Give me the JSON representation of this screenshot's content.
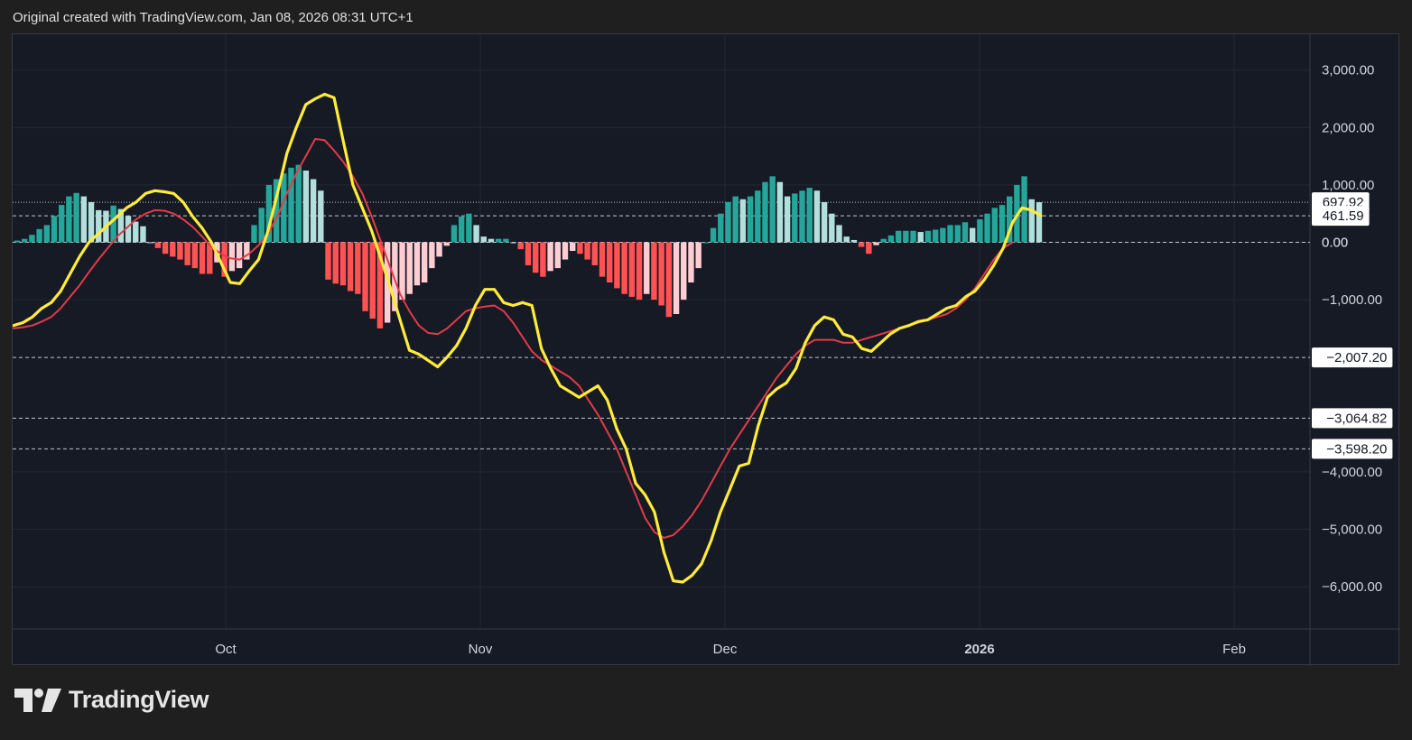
{
  "header": {
    "caption": "Original created with TradingView.com, Jan 08, 2026 08:31 UTC+1"
  },
  "brand": {
    "name": "TradingView",
    "logo_icon": "tradingview-logo-icon"
  },
  "colors": {
    "background": "#1f1f1f",
    "pane": "#161a25",
    "grid": "#242834",
    "axis_text": "#d1d4dc",
    "macd_line": "#ffeb3b",
    "signal_line": "#e23a48",
    "hist_pos_up": "#26a69a",
    "hist_pos_down": "#b2dfdb",
    "hist_neg_down": "#ff5252",
    "hist_neg_up": "#ffcdd2"
  },
  "chart_data": {
    "type": "line",
    "title": "",
    "xlabel": "",
    "ylabel": "",
    "ylim": [
      -6200,
      3400
    ],
    "x_ticks": [
      {
        "label": "Oct",
        "bold": false
      },
      {
        "label": "Nov",
        "bold": false
      },
      {
        "label": "Dec",
        "bold": false
      },
      {
        "label": "2026",
        "bold": true
      },
      {
        "label": "Feb",
        "bold": false
      }
    ],
    "y_ticks": [
      "3,000.00",
      "2,000.00",
      "1,000.00",
      "0.00",
      "−1,000.00",
      "−4,000.00",
      "−5,000.00",
      "−6,000.00"
    ],
    "y_tick_values": [
      3000,
      2000,
      1000,
      0,
      -1000,
      -4000,
      -5000,
      -6000
    ],
    "price_labels": [
      {
        "text": "697.92",
        "value": 697.92,
        "style": "dotted"
      },
      {
        "text": "461.59",
        "value": 461.59,
        "style": "dashed"
      },
      {
        "text": "−2,007.20",
        "value": -2007.2,
        "style": "dashed"
      },
      {
        "text": "−3,064.82",
        "value": -3064.82,
        "style": "dashed"
      },
      {
        "text": "−3,598.20",
        "value": -3598.2,
        "style": "dashed"
      }
    ],
    "zero_line_label": "0.00",
    "grid": true,
    "legend": "none",
    "series": [
      {
        "kind": "line",
        "color": "#ffeb3b",
        "points": [
          [
            0,
            -1450
          ],
          [
            1,
            -1400
          ],
          [
            2,
            -1300
          ],
          [
            3,
            -1150
          ],
          [
            4,
            -1050
          ],
          [
            5,
            -850
          ],
          [
            6,
            -550
          ],
          [
            7,
            -250
          ],
          [
            8,
            0
          ],
          [
            9,
            150
          ],
          [
            10,
            300
          ],
          [
            11,
            450
          ],
          [
            12,
            600
          ],
          [
            13,
            700
          ],
          [
            14,
            850
          ],
          [
            15,
            900
          ],
          [
            16,
            880
          ],
          [
            17,
            850
          ],
          [
            18,
            700
          ],
          [
            19,
            450
          ],
          [
            20,
            250
          ],
          [
            21,
            0
          ],
          [
            22,
            -350
          ],
          [
            23,
            -700
          ],
          [
            24,
            -720
          ],
          [
            25,
            -500
          ],
          [
            26,
            -300
          ],
          [
            27,
            200
          ],
          [
            28,
            850
          ],
          [
            29,
            1550
          ],
          [
            30,
            2000
          ],
          [
            31,
            2400
          ],
          [
            32,
            2500
          ],
          [
            33,
            2580
          ],
          [
            34,
            2520
          ],
          [
            35,
            1750
          ],
          [
            36,
            1000
          ],
          [
            37,
            600
          ],
          [
            38,
            200
          ],
          [
            39,
            -300
          ],
          [
            40,
            -800
          ],
          [
            41,
            -1350
          ],
          [
            42,
            -1880
          ],
          [
            43,
            -1950
          ],
          [
            44,
            -2060
          ],
          [
            45,
            -2170
          ],
          [
            46,
            -2000
          ],
          [
            47,
            -1800
          ],
          [
            48,
            -1500
          ],
          [
            49,
            -1100
          ],
          [
            50,
            -820
          ],
          [
            51,
            -820
          ],
          [
            52,
            -1050
          ],
          [
            53,
            -1100
          ],
          [
            54,
            -1050
          ],
          [
            55,
            -1100
          ],
          [
            56,
            -1850
          ],
          [
            57,
            -2200
          ],
          [
            58,
            -2500
          ],
          [
            59,
            -2600
          ],
          [
            60,
            -2700
          ],
          [
            61,
            -2600
          ],
          [
            62,
            -2500
          ],
          [
            63,
            -2750
          ],
          [
            64,
            -3250
          ],
          [
            65,
            -3600
          ],
          [
            66,
            -4200
          ],
          [
            67,
            -4400
          ],
          [
            68,
            -4700
          ],
          [
            69,
            -5400
          ],
          [
            70,
            -5900
          ],
          [
            71,
            -5920
          ],
          [
            72,
            -5800
          ],
          [
            73,
            -5600
          ],
          [
            74,
            -5200
          ],
          [
            75,
            -4700
          ],
          [
            76,
            -4300
          ],
          [
            77,
            -3900
          ],
          [
            78,
            -3850
          ],
          [
            79,
            -3200
          ],
          [
            80,
            -2700
          ],
          [
            81,
            -2550
          ],
          [
            82,
            -2450
          ],
          [
            83,
            -2200
          ],
          [
            84,
            -1750
          ],
          [
            85,
            -1450
          ],
          [
            86,
            -1300
          ],
          [
            87,
            -1350
          ],
          [
            88,
            -1600
          ],
          [
            89,
            -1650
          ],
          [
            90,
            -1850
          ],
          [
            91,
            -1900
          ],
          [
            92,
            -1750
          ],
          [
            93,
            -1600
          ],
          [
            94,
            -1500
          ],
          [
            95,
            -1450
          ],
          [
            96,
            -1380
          ],
          [
            97,
            -1350
          ],
          [
            98,
            -1250
          ],
          [
            99,
            -1150
          ],
          [
            100,
            -1100
          ],
          [
            101,
            -950
          ],
          [
            102,
            -850
          ],
          [
            103,
            -650
          ],
          [
            104,
            -400
          ],
          [
            105,
            -100
          ],
          [
            106,
            350
          ],
          [
            107,
            600
          ],
          [
            108,
            560
          ],
          [
            109,
            461.59
          ]
        ]
      },
      {
        "kind": "line",
        "color": "#e23a48",
        "points": [
          [
            0,
            -1500
          ],
          [
            1,
            -1480
          ],
          [
            2,
            -1450
          ],
          [
            3,
            -1380
          ],
          [
            4,
            -1300
          ],
          [
            5,
            -1150
          ],
          [
            6,
            -950
          ],
          [
            7,
            -750
          ],
          [
            8,
            -520
          ],
          [
            9,
            -300
          ],
          [
            10,
            -100
          ],
          [
            11,
            100
          ],
          [
            12,
            250
          ],
          [
            13,
            400
          ],
          [
            14,
            500
          ],
          [
            15,
            560
          ],
          [
            16,
            550
          ],
          [
            17,
            500
          ],
          [
            18,
            400
          ],
          [
            19,
            270
          ],
          [
            20,
            100
          ],
          [
            21,
            -80
          ],
          [
            22,
            -200
          ],
          [
            23,
            -280
          ],
          [
            24,
            -300
          ],
          [
            25,
            -200
          ],
          [
            26,
            -50
          ],
          [
            27,
            150
          ],
          [
            28,
            450
          ],
          [
            29,
            850
          ],
          [
            30,
            1200
          ],
          [
            31,
            1500
          ],
          [
            32,
            1800
          ],
          [
            33,
            1780
          ],
          [
            34,
            1600
          ],
          [
            35,
            1400
          ],
          [
            36,
            1150
          ],
          [
            37,
            850
          ],
          [
            38,
            450
          ],
          [
            39,
            0
          ],
          [
            40,
            -450
          ],
          [
            41,
            -900
          ],
          [
            42,
            -1200
          ],
          [
            43,
            -1450
          ],
          [
            44,
            -1580
          ],
          [
            45,
            -1600
          ],
          [
            46,
            -1500
          ],
          [
            47,
            -1350
          ],
          [
            48,
            -1200
          ],
          [
            49,
            -1150
          ],
          [
            50,
            -1120
          ],
          [
            51,
            -1100
          ],
          [
            52,
            -1200
          ],
          [
            53,
            -1400
          ],
          [
            54,
            -1650
          ],
          [
            55,
            -1900
          ],
          [
            56,
            -2050
          ],
          [
            57,
            -2150
          ],
          [
            58,
            -2250
          ],
          [
            59,
            -2350
          ],
          [
            60,
            -2500
          ],
          [
            61,
            -2750
          ],
          [
            62,
            -3000
          ],
          [
            63,
            -3300
          ],
          [
            64,
            -3600
          ],
          [
            65,
            -4000
          ],
          [
            66,
            -4400
          ],
          [
            67,
            -4800
          ],
          [
            68,
            -5050
          ],
          [
            69,
            -5150
          ],
          [
            70,
            -5100
          ],
          [
            71,
            -4950
          ],
          [
            72,
            -4750
          ],
          [
            73,
            -4500
          ],
          [
            74,
            -4200
          ],
          [
            75,
            -3900
          ],
          [
            76,
            -3600
          ],
          [
            77,
            -3350
          ],
          [
            78,
            -3100
          ],
          [
            79,
            -2850
          ],
          [
            80,
            -2600
          ],
          [
            81,
            -2350
          ],
          [
            82,
            -2150
          ],
          [
            83,
            -1950
          ],
          [
            84,
            -1800
          ],
          [
            85,
            -1700
          ],
          [
            86,
            -1700
          ],
          [
            87,
            -1700
          ],
          [
            88,
            -1750
          ],
          [
            89,
            -1750
          ],
          [
            90,
            -1700
          ],
          [
            91,
            -1650
          ],
          [
            92,
            -1600
          ],
          [
            93,
            -1550
          ],
          [
            94,
            -1500
          ],
          [
            95,
            -1450
          ],
          [
            96,
            -1400
          ],
          [
            97,
            -1350
          ],
          [
            98,
            -1300
          ],
          [
            99,
            -1250
          ],
          [
            100,
            -1150
          ],
          [
            101,
            -1000
          ],
          [
            102,
            -800
          ],
          [
            103,
            -550
          ],
          [
            104,
            -300
          ],
          [
            105,
            -100
          ],
          [
            106,
            0
          ]
        ]
      },
      {
        "kind": "histogram",
        "values": [
          30,
          60,
          130,
          230,
          300,
          460,
          650,
          800,
          860,
          800,
          700,
          560,
          550,
          640,
          580,
          460,
          360,
          280,
          0,
          -100,
          -200,
          -250,
          -300,
          -400,
          -450,
          -550,
          -550,
          -350,
          -600,
          -500,
          -450,
          -300,
          300,
          600,
          1000,
          1100,
          1200,
          1300,
          1350,
          1250,
          1100,
          900,
          -650,
          -720,
          -750,
          -850,
          -900,
          -1200,
          -1330,
          -1500,
          -1400,
          -1200,
          -1000,
          -900,
          -750,
          -700,
          -450,
          -250,
          -60,
          300,
          450,
          500,
          300,
          100,
          60,
          60,
          60,
          0,
          -120,
          -400,
          -530,
          -600,
          -500,
          -450,
          -300,
          -150,
          -200,
          -300,
          -400,
          -600,
          -700,
          -800,
          -900,
          -950,
          -1000,
          -900,
          -1000,
          -1100,
          -1300,
          -1250,
          -1000,
          -700,
          -450,
          0,
          250,
          500,
          700,
          800,
          750,
          800,
          900,
          1050,
          1150,
          1050,
          800,
          850,
          900,
          950,
          900,
          700,
          500,
          300,
          100,
          40,
          -80,
          -200,
          -50,
          60,
          120,
          200,
          200,
          200,
          180,
          200,
          220,
          250,
          300,
          300,
          350,
          250,
          400,
          500,
          600,
          650,
          800,
          1000,
          1150,
          750,
          697.92
        ]
      }
    ]
  }
}
